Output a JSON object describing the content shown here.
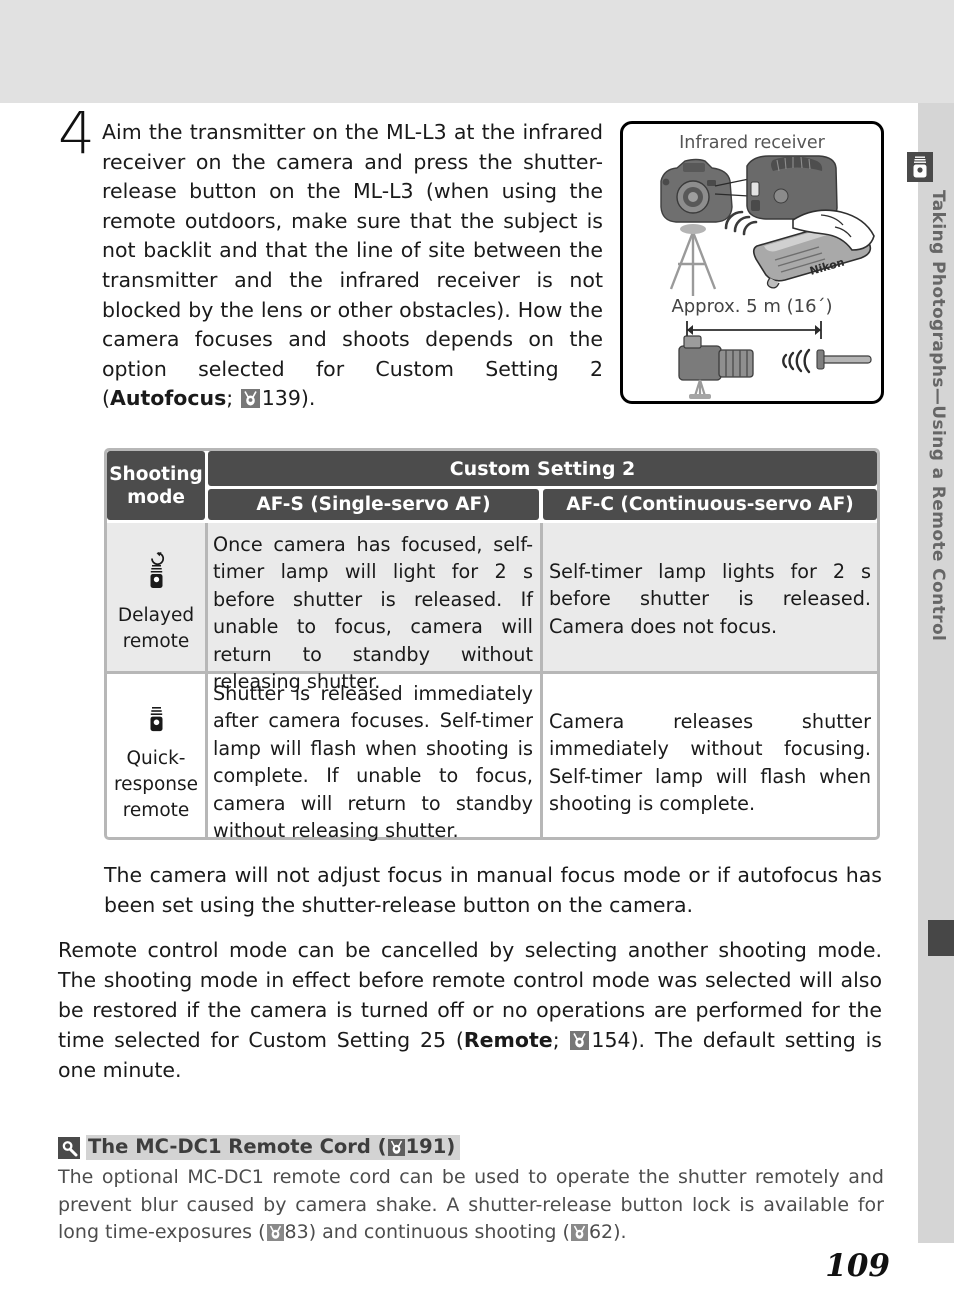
{
  "page": {
    "number": "109",
    "sidebar_title": "Taking Photographs—Using a Remote Control",
    "sidebar_icon": "remote-control-icon"
  },
  "step": {
    "number": "4",
    "text_before_bold": "Aim the transmitter on the ML-L3 at the infrared receiver on the camera and press the shutter-release button on the ML-L3 (when using the remote outdoors, make sure that the subject is not backlit and that the line of site between the transmitter and the infrared receiver is not blocked by the lens or other obstacles).  How the camera focuses and shoots depends on the option selected for Custom Setting 2 (",
    "bold_term": "Autofocus",
    "text_mid": "; ",
    "page_ref": "139",
    "text_after": ")."
  },
  "illustration": {
    "label": "Infrared receiver",
    "distance": "Approx. 5 m (16´)",
    "icons": [
      "camera-on-tripod-icon",
      "infrared-receiver-icon",
      "ml-l3-remote-in-hand-icon",
      "camera-side-view-icon",
      "ir-signal-waves-icon"
    ]
  },
  "table": {
    "header": {
      "mode_col": "Shooting mode",
      "mode_col_line1": "Shooting",
      "mode_col_line2": "mode",
      "group": "Custom Setting 2",
      "col_afs": "AF-S (Single-servo AF)",
      "col_afc": "AF-C (Continuous-servo AF)"
    },
    "rows": [
      {
        "mode_icon": "delayed-remote-icon",
        "mode_line1": "Delayed",
        "mode_line2": "remote",
        "afs": "Once camera has focused, self-timer lamp will light for 2 s before shutter is released.  If unable to focus, camera will return to standby without releasing shutter.",
        "afc": "Self-timer lamp lights for 2 s before shutter is released.   Camera does not focus."
      },
      {
        "mode_icon": "quick-response-remote-icon",
        "mode_line1": "Quick-",
        "mode_line2": "response",
        "mode_line3": "remote",
        "afs": "Shutter is released immediately after camera focuses.   Self-timer lamp will flash when shooting is complete.   If unable to focus, camera will return to standby without releasing shutter.",
        "afc": "Camera releases shutter immediately without focusing.  Self-timer lamp will flash when shooting is complete."
      }
    ]
  },
  "paragraphs": {
    "indented": "The camera will not adjust focus in manual focus mode or if autofocus has been set using the shutter-release button on the camera.",
    "full_part1": "Remote control mode can be cancelled by selecting another shooting mode.  The shooting mode in effect before remote control mode was selected will also be restored if the camera is turned off or no operations are performed for the time selected for Custom Setting 25 (",
    "full_bold": "Remote",
    "full_mid": "; ",
    "full_ref": "154",
    "full_part2": ").  The default setting is one minute."
  },
  "note": {
    "icon": "tip-magnifier-icon",
    "title_text": "The MC-DC1 Remote Cord (",
    "title_ref": "191",
    "title_close": ")",
    "body_part1": "The optional MC-DC1 remote cord can be used to operate the shutter remotely and prevent blur caused by camera shake.  A shutter-release button lock is available for long time-exposures (",
    "body_ref1": "83",
    "body_part2": ") and continuous shooting (",
    "body_ref2": "62",
    "body_part3": ")."
  },
  "colors": {
    "header_dark": "#4c4c4c",
    "row_shade": "#eaeaea",
    "border_grey": "#b7b7b7",
    "rail_grey": "#d5d5d5",
    "band_grey": "#e1e1e1",
    "note_grey": "#4d4d4d"
  }
}
